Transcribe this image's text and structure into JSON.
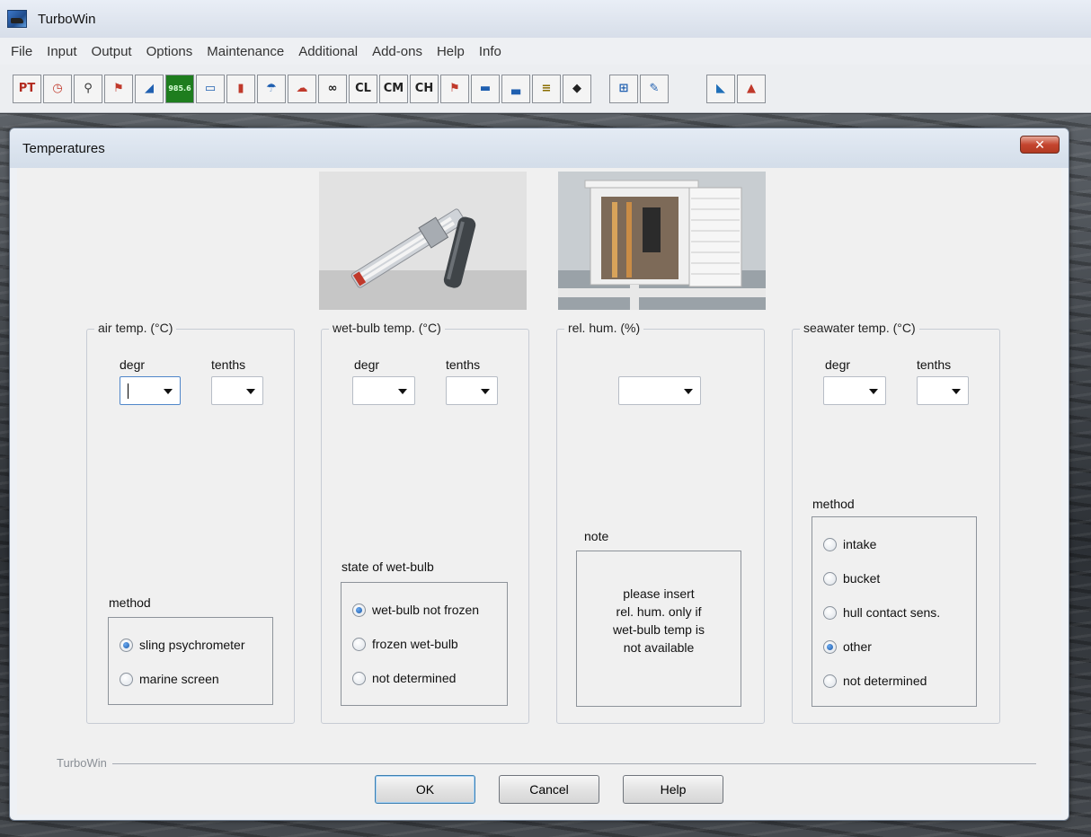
{
  "app": {
    "title": "TurboWin"
  },
  "menu": {
    "items": [
      "File",
      "Input",
      "Output",
      "Options",
      "Maintenance",
      "Additional",
      "Add-ons",
      "Help",
      "Info"
    ]
  },
  "toolbar": {
    "icons": [
      {
        "name": "ptit-icon",
        "glyph": "PT"
      },
      {
        "name": "clock-icon",
        "glyph": "◷"
      },
      {
        "name": "compass-icon",
        "glyph": "⚲"
      },
      {
        "name": "flag-icon",
        "glyph": "⚑"
      },
      {
        "name": "wave-icon",
        "glyph": "◢"
      },
      {
        "name": "pressure-display-icon",
        "glyph": "985.6"
      },
      {
        "name": "barograph-icon",
        "glyph": "▭"
      },
      {
        "name": "thermometer-icon",
        "glyph": "▮"
      },
      {
        "name": "weather-icon",
        "glyph": "☂"
      },
      {
        "name": "weather-past-icon",
        "glyph": "☁"
      },
      {
        "name": "binoculars-icon",
        "glyph": "∞"
      },
      {
        "name": "cloud-low-icon",
        "glyph": "CL"
      },
      {
        "name": "cloud-mid-icon",
        "glyph": "CM"
      },
      {
        "name": "cloud-high-icon",
        "glyph": "CH"
      },
      {
        "name": "anemometer-icon",
        "glyph": "⚑"
      },
      {
        "name": "ship-icon",
        "glyph": "▬"
      },
      {
        "name": "sea-ice-icon",
        "glyph": "▃"
      },
      {
        "name": "ice-accretion-icon",
        "glyph": "≡"
      },
      {
        "name": "tag-icon",
        "glyph": "◆"
      }
    ],
    "icons_group2": [
      {
        "name": "observer-icon",
        "glyph": "⊞"
      },
      {
        "name": "feather-icon",
        "glyph": "✎"
      }
    ],
    "icons_group3": [
      {
        "name": "dolphin-icon",
        "glyph": "◣"
      },
      {
        "name": "volcano-icon",
        "glyph": "▲"
      }
    ]
  },
  "dialog": {
    "title": "Temperatures",
    "close_label": "✕",
    "air": {
      "legend": "air temp. (°C)",
      "degr_label": "degr",
      "tenths_label": "tenths",
      "method_label": "method",
      "methods": [
        {
          "label": "sling psychrometer",
          "checked": true
        },
        {
          "label": "marine screen",
          "checked": false
        }
      ]
    },
    "wet": {
      "legend": "wet-bulb temp. (°C)",
      "degr_label": "degr",
      "tenths_label": "tenths",
      "state_label": "state of wet-bulb",
      "states": [
        {
          "label": "wet-bulb not frozen",
          "checked": true
        },
        {
          "label": "frozen wet-bulb",
          "checked": false
        },
        {
          "label": "not determined",
          "checked": false
        }
      ]
    },
    "rh": {
      "legend": "rel. hum. (%)",
      "note_label": "note",
      "note_lines": [
        "please insert",
        "rel. hum. only if",
        "wet-bulb temp is",
        "not available"
      ]
    },
    "sea": {
      "legend": "seawater temp. (°C)",
      "degr_label": "degr",
      "tenths_label": "tenths",
      "method_label": "method",
      "methods": [
        {
          "label": "intake",
          "checked": false
        },
        {
          "label": "bucket",
          "checked": false
        },
        {
          "label": "hull contact sens.",
          "checked": false
        },
        {
          "label": "other",
          "checked": true
        },
        {
          "label": "not determined",
          "checked": false
        }
      ]
    },
    "footer_label": "TurboWin",
    "buttons": {
      "ok": "OK",
      "cancel": "Cancel",
      "help": "Help"
    }
  },
  "colors": {
    "accent": "#1c5aa8",
    "close": "#c4452f"
  }
}
